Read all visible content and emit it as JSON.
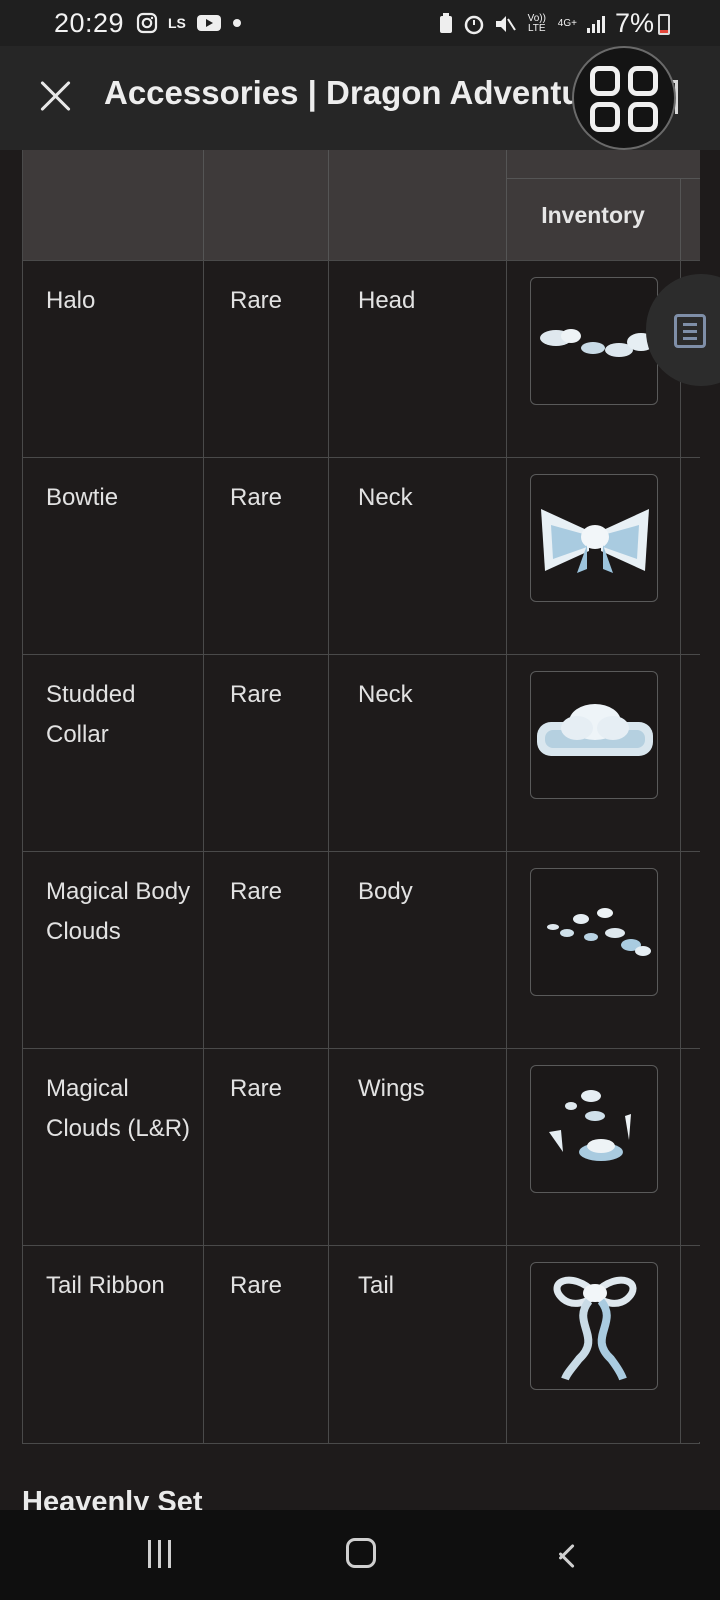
{
  "status_bar": {
    "time": "20:29",
    "carrier_icon_text": "LS",
    "signal_text_top": "Vo)) LTE",
    "network_text": "4G+",
    "battery": "7%"
  },
  "browser": {
    "title": "Accessories | Dragon Adventures",
    "close_icon": "close-icon",
    "bookmark_icon": "bookmark-icon"
  },
  "table": {
    "header": {
      "image_column": "Inventory"
    },
    "rows": [
      {
        "name": "Halo",
        "rarity": "Rare",
        "slot": "Head",
        "icon": "halo-icon"
      },
      {
        "name": "Bowtie",
        "rarity": "Rare",
        "slot": "Neck",
        "icon": "bowtie-icon"
      },
      {
        "name": "Studded Collar",
        "rarity": "Rare",
        "slot": "Neck",
        "icon": "studded-collar-icon"
      },
      {
        "name": "Magical Body Clouds",
        "rarity": "Rare",
        "slot": "Body",
        "icon": "magical-body-clouds-icon"
      },
      {
        "name": "Magical Clouds (L&R)",
        "rarity": "Rare",
        "slot": "Wings",
        "icon": "magical-clouds-icon"
      },
      {
        "name": "Tail Ribbon",
        "rarity": "Rare",
        "slot": "Tail",
        "icon": "tail-ribbon-icon"
      }
    ]
  },
  "next_section": {
    "heading": "Heavenly Set"
  },
  "colors": {
    "background": "#1e1b1b",
    "header_bg": "#3e3a3a",
    "accent_cloud": "#a9cbe0"
  }
}
